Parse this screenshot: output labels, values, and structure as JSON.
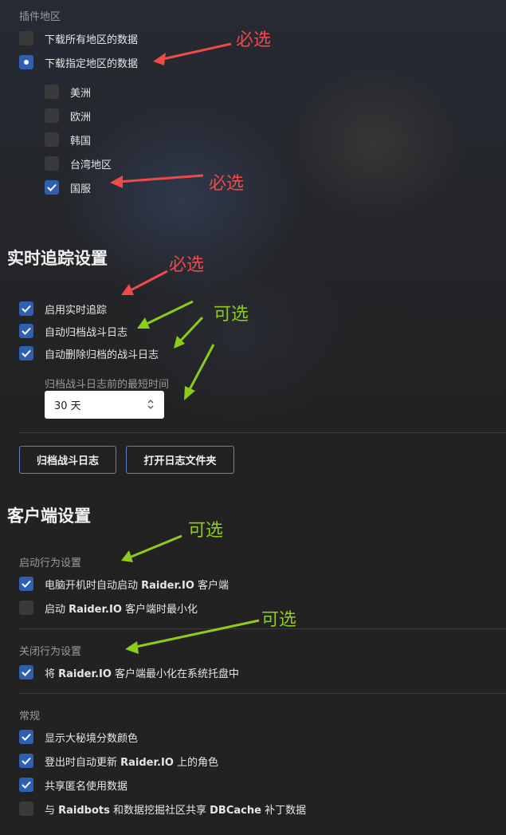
{
  "addon_region": {
    "title": "插件地区",
    "options": [
      {
        "label": "下载所有地区的数据",
        "selected": false
      },
      {
        "label": "下载指定地区的数据",
        "selected": true
      }
    ],
    "regions": [
      {
        "label": "美洲",
        "checked": false
      },
      {
        "label": "欧洲",
        "checked": false
      },
      {
        "label": "韩国",
        "checked": false
      },
      {
        "label": "台湾地区",
        "checked": false
      },
      {
        "label": "国服",
        "checked": true
      }
    ]
  },
  "realtime": {
    "title": "实时追踪设置",
    "options": [
      {
        "label": "启用实时追踪",
        "checked": true
      },
      {
        "label": "自动归档战斗日志",
        "checked": true
      },
      {
        "label": "自动删除归档的战斗日志",
        "checked": true
      }
    ],
    "min_time_label": "归档战斗日志前的最短时间",
    "min_time_value": "30 天",
    "buttons": {
      "archive": "归档战斗日志",
      "open_folder": "打开日志文件夹"
    }
  },
  "client": {
    "title": "客户端设置",
    "startup": {
      "title": "启动行为设置",
      "options": [
        {
          "pre": "电脑开机时自动启动 ",
          "brand": "Raider.IO",
          "post": " 客户端",
          "checked": true
        },
        {
          "pre": "启动 ",
          "brand": "Raider.IO",
          "post": " 客户端时最小化",
          "checked": false
        }
      ]
    },
    "close": {
      "title": "关闭行为设置",
      "options": [
        {
          "pre": "将 ",
          "brand": "Raider.IO",
          "post": " 客户端最小化在系统托盘中",
          "checked": true
        }
      ]
    },
    "general": {
      "title": "常规",
      "options": [
        {
          "pre": "显示大秘境分数颜色",
          "brand": "",
          "post": "",
          "checked": true
        },
        {
          "pre": "登出时自动更新 ",
          "brand": "Raider.IO",
          "post": " 上的角色",
          "checked": true
        },
        {
          "pre": "共享匿名使用数据",
          "brand": "",
          "post": "",
          "checked": true
        },
        {
          "pre": "与 ",
          "brand": "Raidbots",
          "post": " 和数据挖掘社区共享 ",
          "brand2": "DBCache",
          "post2": " 补丁数据",
          "checked": false
        }
      ]
    }
  },
  "annotations": {
    "required": "必选",
    "optional": "可选"
  },
  "colors": {
    "accent": "#2f5fb0",
    "annotation_red": "#ee4a4a",
    "annotation_green": "#8ccc1a"
  }
}
